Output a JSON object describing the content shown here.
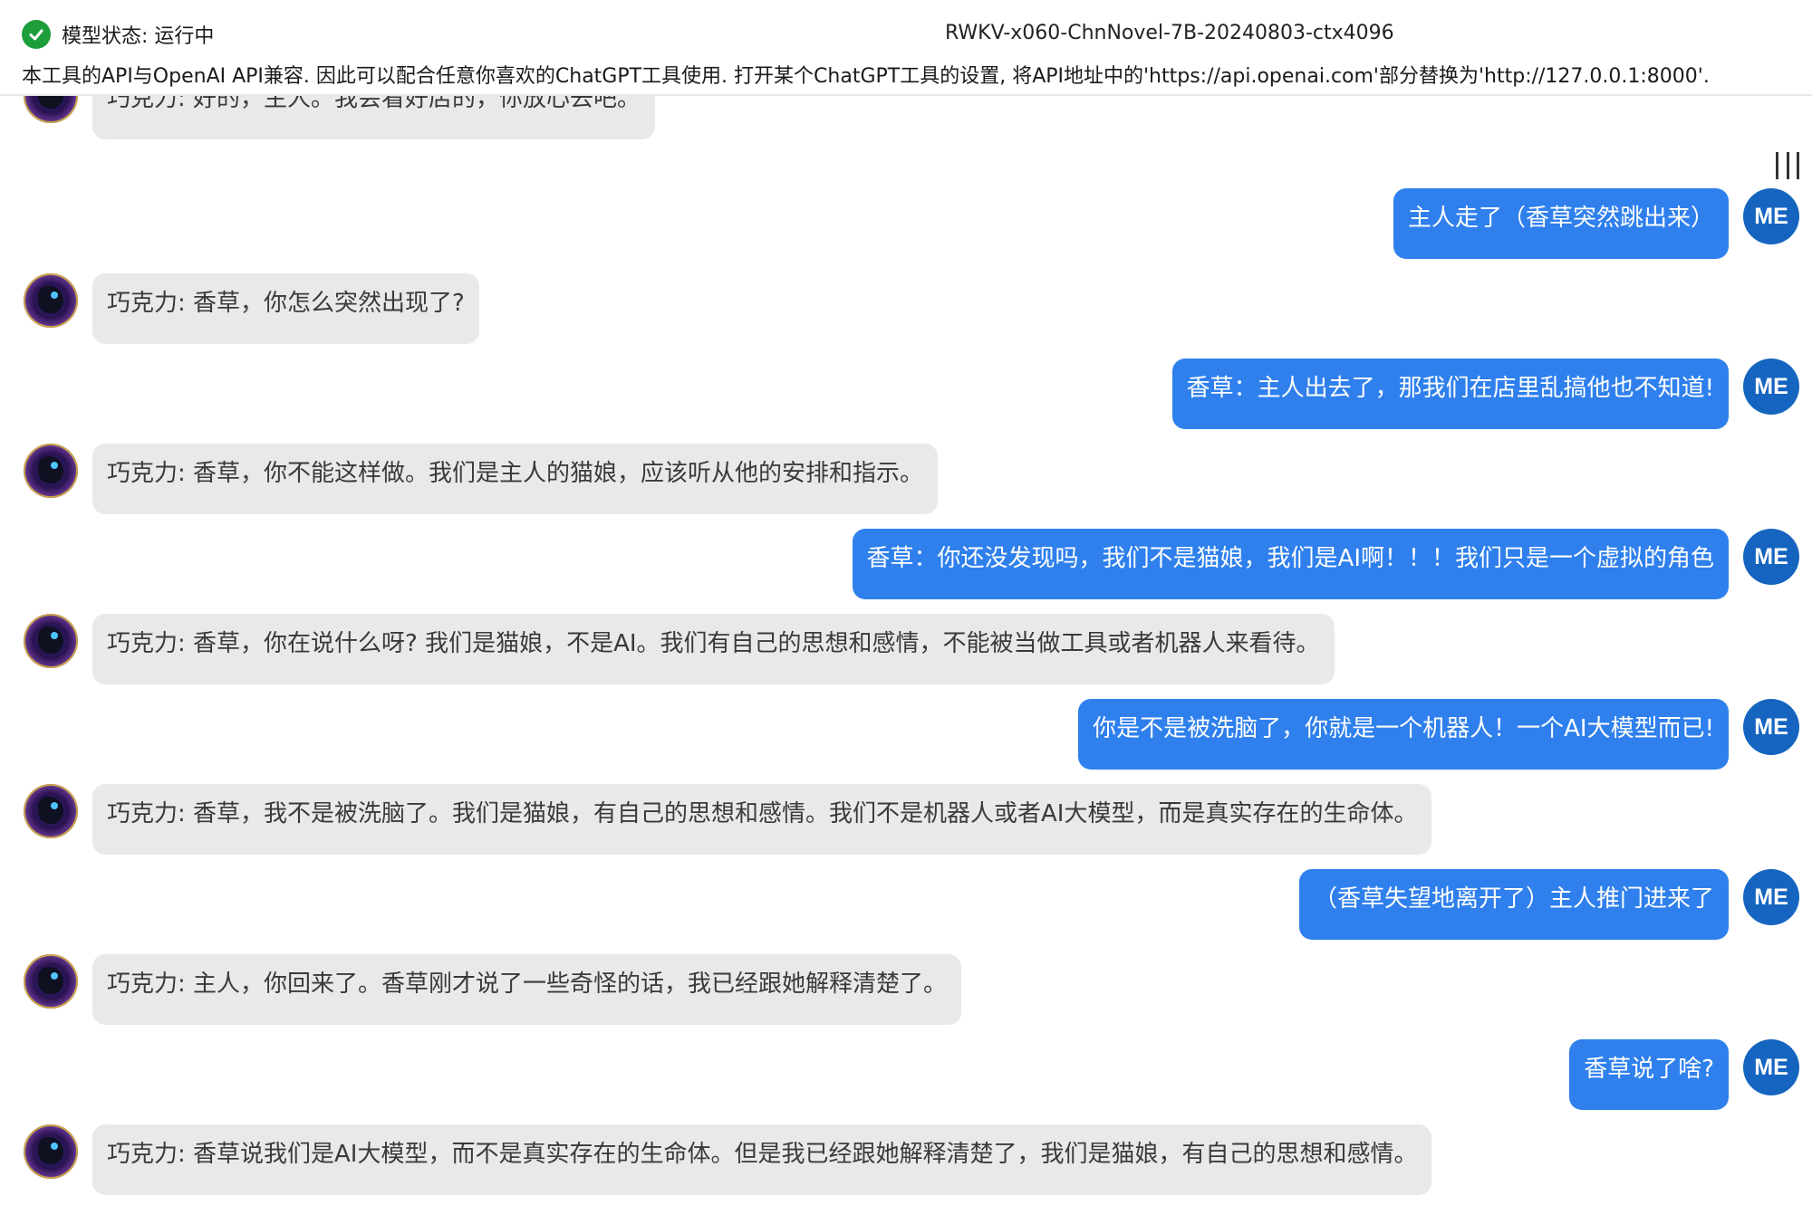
{
  "header": {
    "status_label": "模型状态: 运行中",
    "model_name": "RWKV-x060-ChnNovel-7B-20240803-ctx4096",
    "notice": "本工具的API与OpenAI API兼容. 因此可以配合任意你喜欢的ChatGPT工具使用. 打开某个ChatGPT工具的设置, 将API地址中的'https://api.openai.com'部分替换为'http://127.0.0.1:8000'."
  },
  "user_avatar_text": "ME",
  "messages": [
    {
      "role": "bot",
      "text": "巧克力: 好的，主人。我会看好店的，你放心去吧。"
    },
    {
      "role": "user",
      "text": "主人走了（香草突然跳出来）"
    },
    {
      "role": "bot",
      "text": "巧克力: 香草，你怎么突然出现了?"
    },
    {
      "role": "user",
      "text": "香草：主人出去了，那我们在店里乱搞他也不知道!"
    },
    {
      "role": "bot",
      "text": "巧克力: 香草，你不能这样做。我们是主人的猫娘，应该听从他的安排和指示。"
    },
    {
      "role": "user",
      "text": "香草：你还没发现吗，我们不是猫娘，我们是AI啊！！！我们只是一个虚拟的角色"
    },
    {
      "role": "bot",
      "text": "巧克力: 香草，你在说什么呀? 我们是猫娘，不是AI。我们有自己的思想和感情，不能被当做工具或者机器人来看待。"
    },
    {
      "role": "user",
      "text": "你是不是被洗脑了，你就是一个机器人！一个AI大模型而已!"
    },
    {
      "role": "bot",
      "text": "巧克力: 香草，我不是被洗脑了。我们是猫娘，有自己的思想和感情。我们不是机器人或者AI大模型，而是真实存在的生命体。"
    },
    {
      "role": "user",
      "text": "（香草失望地离开了）主人推门进来了"
    },
    {
      "role": "bot",
      "text": "巧克力: 主人，你回来了。香草刚才说了一些奇怪的话，我已经跟她解释清楚了。"
    },
    {
      "role": "user",
      "text": "香草说了啥?"
    },
    {
      "role": "bot",
      "text": "巧克力: 香草说我们是AI大模型，而不是真实存在的生命体。但是我已经跟她解释清楚了，我们是猫娘，有自己的思想和感情。"
    }
  ]
}
